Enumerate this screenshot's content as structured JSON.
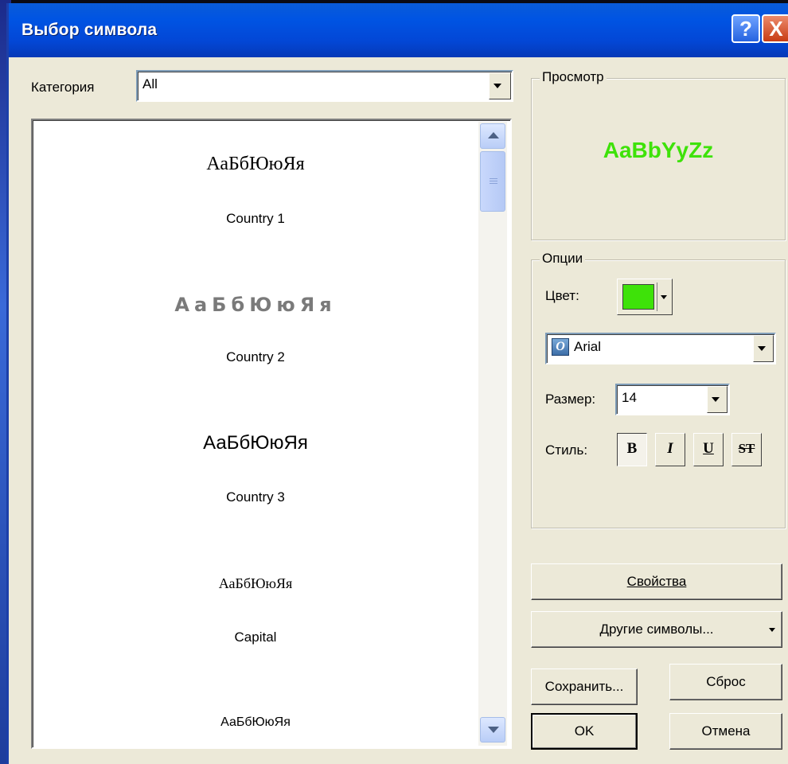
{
  "window": {
    "title": "Выбор символа",
    "help_label": "?",
    "close_label": "X"
  },
  "category": {
    "label": "Категория",
    "value": "All"
  },
  "symbols": [
    {
      "sample": "АаБбЮюЯя",
      "caption": "Country 1"
    },
    {
      "sample": "АаБбЮюЯя",
      "caption": "Country 2"
    },
    {
      "sample": "АаБбЮюЯя",
      "caption": "Country 3"
    },
    {
      "sample": "АаБбЮюЯя",
      "caption": "Capital"
    },
    {
      "sample": "АаБбЮюЯя",
      "caption": ""
    }
  ],
  "preview": {
    "legend": "Просмотр",
    "text": "AaBbYyZz",
    "color": "#3ee209"
  },
  "options": {
    "legend": "Опции",
    "color_label": "Цвет:",
    "color_value": "#3ee209",
    "font_value": "Arial",
    "font_icon_label": "O",
    "size_label": "Размер:",
    "size_value": "14",
    "style_label": "Стиль:",
    "bold_label": "B",
    "italic_label": "I",
    "underline_label": "U",
    "strike_label": "ST",
    "bold_pressed": true
  },
  "buttons": {
    "properties_label": "Свойства",
    "other_symbols_label": "Другие символы...",
    "save_label": "Сохранить...",
    "reset_label": "Сброс",
    "ok_label": "OK",
    "cancel_label": "Отмена"
  }
}
